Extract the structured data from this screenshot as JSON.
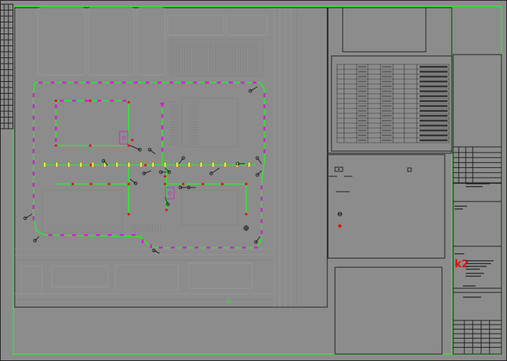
{
  "drawing": {
    "type": "site electrical / lighting plan",
    "colors": {
      "background": "#8c8c8c",
      "border_line": "#2fe82f",
      "frame_line": "#1b1b1b",
      "fixture_marker": "#d21ed2",
      "device_marker": "#e01010",
      "logo_accent": "#e01010"
    }
  },
  "title_block": {
    "logo_glyph": "k2"
  }
}
